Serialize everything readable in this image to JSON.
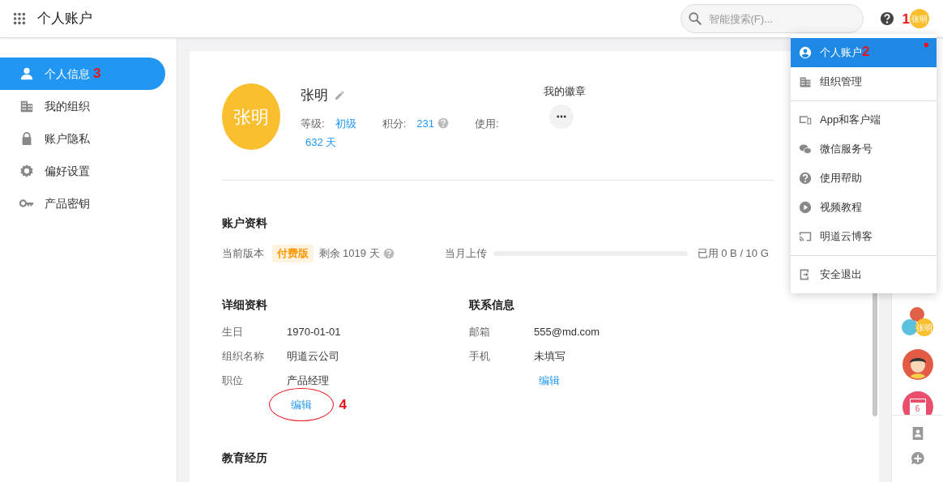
{
  "header": {
    "title": "个人账户",
    "search": {
      "placeholder": "智能搜索(F)..."
    },
    "avatar": {
      "text": "张明",
      "annotation": "1"
    }
  },
  "sidebar": {
    "items": [
      {
        "label": "个人信息",
        "selected": true,
        "annotation": "3"
      },
      {
        "label": "我的组织",
        "selected": false
      },
      {
        "label": "账户隐私",
        "selected": false
      },
      {
        "label": "偏好设置",
        "selected": false
      },
      {
        "label": "产品密钥",
        "selected": false
      }
    ]
  },
  "profile": {
    "avatar_text": "张明",
    "name": "张明",
    "level_label": "等级:",
    "level": "初级",
    "points_label": "积分:",
    "points": "231",
    "usage_label": "使用:",
    "usage": "632 天",
    "badges_title": "我的徽章"
  },
  "account": {
    "title": "账户资料",
    "version_label": "当前版本",
    "version": "付费版",
    "remaining": "剩余 1019 天",
    "upload_label": "当月上传",
    "upload": {
      "level": 0
    },
    "upload_text": "已用 0 B / 10 G"
  },
  "details": {
    "title": "详细资料",
    "rows": [
      {
        "label": "生日",
        "value": "1970-01-01"
      },
      {
        "label": "组织名称",
        "value": "明道云公司"
      },
      {
        "label": "职位",
        "value": "产品经理"
      }
    ],
    "edit": {
      "label": "编辑",
      "circled": true,
      "annotation": "4"
    }
  },
  "contact": {
    "title": "联系信息",
    "rows": [
      {
        "label": "邮箱",
        "value": "555@md.com"
      },
      {
        "label": "手机",
        "value": "未填写"
      }
    ],
    "edit": {
      "label": "编辑",
      "circled": false
    }
  },
  "education": {
    "title": "教育经历"
  },
  "menu": {
    "groups": [
      [
        {
          "label": "个人账户",
          "selected": true,
          "dot": true,
          "annotation": "2"
        },
        {
          "label": "组织管理",
          "selected": false,
          "dot": false
        }
      ],
      [
        {
          "label": "App和客户端",
          "selected": false,
          "dot": false
        },
        {
          "label": "微信服务号",
          "selected": false,
          "dot": false
        },
        {
          "label": "使用帮助",
          "selected": false,
          "dot": false
        },
        {
          "label": "视频教程",
          "selected": false,
          "dot": false
        },
        {
          "label": "明道云博客",
          "selected": false,
          "dot": false
        }
      ],
      [
        {
          "label": "安全退出",
          "selected": false,
          "dot": false
        }
      ]
    ]
  },
  "rail": {
    "group_avatar_text": "张明",
    "calendar_day": "6"
  }
}
